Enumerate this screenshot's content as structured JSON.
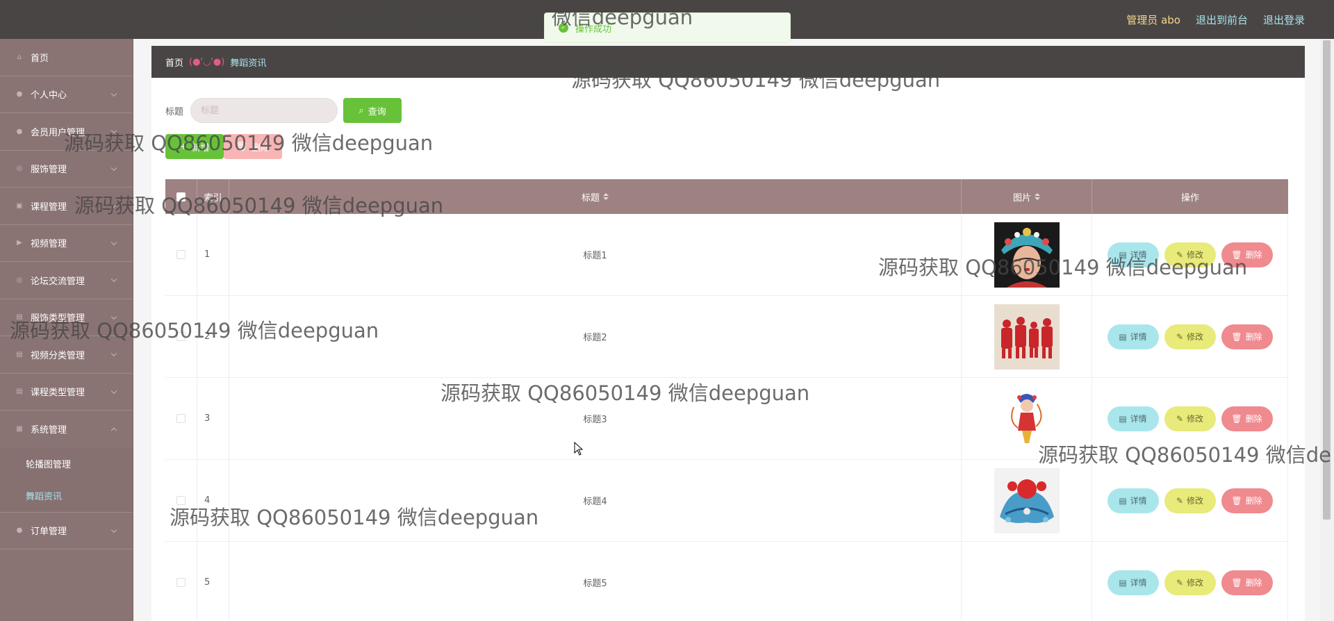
{
  "header": {
    "admin_label": "管理员 abo",
    "to_front_label": "退出到前台",
    "logout_label": "退出登录"
  },
  "toast": {
    "message": "操作成功"
  },
  "sidebar": {
    "items": [
      {
        "label": "首页",
        "icon": "home-icon"
      },
      {
        "label": "个人中心",
        "icon": "user-icon"
      },
      {
        "label": "会员用户管理",
        "icon": "users-icon"
      },
      {
        "label": "服饰管理",
        "icon": "clothes-icon"
      },
      {
        "label": "课程管理",
        "icon": "course-icon"
      },
      {
        "label": "视频管理",
        "icon": "video-icon"
      },
      {
        "label": "论坛交流管理",
        "icon": "forum-icon"
      },
      {
        "label": "服饰类型管理",
        "icon": "category-icon"
      },
      {
        "label": "视频分类管理",
        "icon": "category-icon"
      },
      {
        "label": "课程类型管理",
        "icon": "category-icon"
      },
      {
        "label": "系统管理",
        "icon": "system-icon"
      }
    ],
    "system_sub": [
      {
        "label": "轮播图管理"
      },
      {
        "label": "舞蹈资讯"
      }
    ],
    "last_item": {
      "label": "订单管理",
      "icon": "order-icon"
    }
  },
  "breadcrumb": {
    "home": "首页",
    "separator": "(●'◡'●)",
    "current": "舞蹈资讯"
  },
  "search": {
    "label": "标题",
    "placeholder": "标题",
    "query_button": "查询"
  },
  "actions": {
    "add_button": "新增",
    "delete_button": "删除"
  },
  "table": {
    "columns": {
      "index": "索引",
      "title": "标题",
      "image": "图片",
      "operations": "操作"
    },
    "row_buttons": {
      "detail": "详情",
      "edit": "修改",
      "remove": "删除"
    },
    "rows": [
      {
        "index": "1",
        "title": "标题1",
        "image": "opera-headdress-portrait"
      },
      {
        "index": "2",
        "title": "标题2",
        "image": "red-paper-cut-figures"
      },
      {
        "index": "3",
        "title": "标题3",
        "image": "opera-puppet-figure"
      },
      {
        "index": "4",
        "title": "标题4",
        "image": "blue-red-headdress"
      },
      {
        "index": "5",
        "title": "标题5",
        "image": ""
      }
    ]
  },
  "watermark": {
    "text": "源码获取 QQ86050149 微信deepguan",
    "text_clipped": "源码获取 QQ86050149 微信de"
  },
  "colors": {
    "topbar": "#4a4545",
    "sidebar": "#8a7373",
    "table_header": "#9e8282",
    "accent_green": "#67c23a",
    "accent_cyan": "#a7e3ea",
    "admin_yellow": "#f5d98a"
  }
}
